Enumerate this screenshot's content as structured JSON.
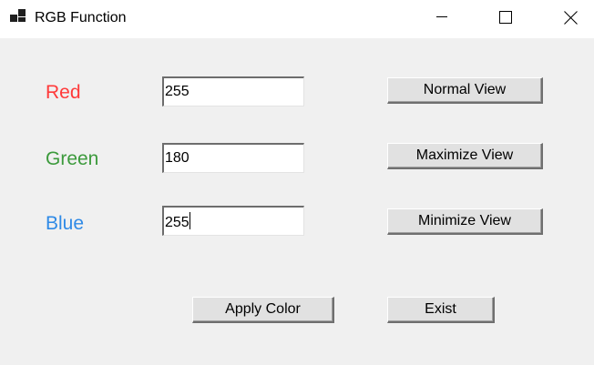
{
  "window": {
    "title": "RGB Function",
    "controls": [
      "minimize",
      "maximize",
      "close"
    ]
  },
  "fields": [
    {
      "label": "Red",
      "value": "255",
      "label_color": "#ff3a3a"
    },
    {
      "label": "Green",
      "value": "180",
      "label_color": "#3c9a3c"
    },
    {
      "label": "Blue",
      "value": "255",
      "label_color": "#2f8ae6"
    }
  ],
  "buttons": {
    "normal_view": "Normal View",
    "maximize_view": "Maximize View",
    "minimize_view": "Minimize View",
    "apply_color": "Apply Color",
    "exist": "Exist"
  },
  "icons": {
    "app": "app-window-icon",
    "minimize": "minimize-icon",
    "maximize": "maximize-icon",
    "close": "close-icon"
  }
}
